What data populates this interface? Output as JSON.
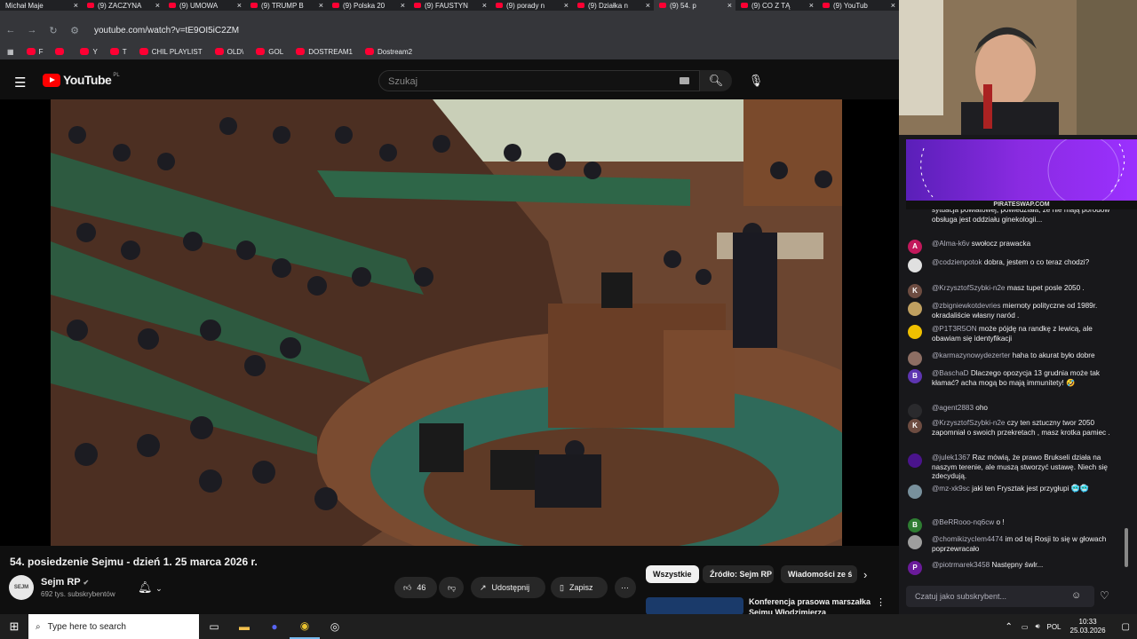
{
  "browser": {
    "tabs": [
      {
        "label": "Michał Maje"
      },
      {
        "label": "(9) ZACZYNA"
      },
      {
        "label": "(9) UMOWA"
      },
      {
        "label": "(9) TRUMP B"
      },
      {
        "label": "(9) Polska 20"
      },
      {
        "label": "(9) FAUSTYN"
      },
      {
        "label": "(9) porady n"
      },
      {
        "label": "(9) Działka n"
      },
      {
        "label": "(9) 54. p"
      },
      {
        "label": "(9) CO Z TĄ"
      },
      {
        "label": "(9) YouTub"
      }
    ],
    "url": "youtube.com/watch?v=tE9OI5iC2ZM",
    "bookmarks": [
      {
        "label": "F"
      },
      {
        "label": ""
      },
      {
        "label": "Y"
      },
      {
        "label": "T"
      },
      {
        "label": "CHIL PLAYLIST"
      },
      {
        "label": "OLD\\"
      },
      {
        "label": "GOL"
      },
      {
        "label": "DOSTREAM1"
      },
      {
        "label": "Dostream2"
      }
    ]
  },
  "youtube": {
    "logo_text": "YouTube",
    "logo_region": "PL",
    "search_placeholder": "Szukaj",
    "video_title": "54. posiedzenie Sejmu - dzień 1. 25 marca 2026 r.",
    "channel": {
      "name": "Sejm RP",
      "subs": "692 tys. subskrybentów",
      "avatar_text": "SEJM"
    },
    "actions": {
      "likes": "46",
      "share": "Udostępnij",
      "save": "Zapisz"
    },
    "chips": [
      "Wszystkie",
      "Źródło: Sejm RP",
      "Wiadomości ze ś"
    ],
    "recommendation": {
      "title": "Konferencja prasowa marszałka Sejmu Włodzimierza"
    }
  },
  "stream": {
    "banner_caption": "PIRATESWAP.COM",
    "chat_input_placeholder": "Czatuj jako subskrybent...",
    "messages": [
      {
        "user": "",
        "text": "sytuacja powiatowej, powiedziała, że nie mają porodów obsługa jest oddziału ginekologii...",
        "av": "",
        "color": "#3a3a3d"
      },
      {
        "user": "@Alma-k6v",
        "text": "swołocz prawacka",
        "av": "A",
        "color": "#c2185b"
      },
      {
        "user": "@codzienpotok",
        "text": "dobra, jestem o co teraz chodzi?",
        "av": "",
        "color": "#e0e0e0"
      },
      {
        "user": "@KrzysztofSzybki-n2e",
        "text": "masz tupet posle 2050 .",
        "av": "K",
        "color": "#6d4c41"
      },
      {
        "user": "@zbigniewkotdevries",
        "text": "miernoty polityczne od 1989r. okradaliście własny naród .",
        "av": "",
        "color": "#c0a060"
      },
      {
        "user": "@P1T3R5ON",
        "text": "może pójdę na randkę z lewicą, ale obawiam się identyfikacji",
        "av": "",
        "color": "#f0c000"
      },
      {
        "user": "@karmazynowydezerter",
        "text": "haha to akurat było dobre",
        "av": "",
        "color": "#8d6e63"
      },
      {
        "user": "@BaschaD",
        "text": "Dlaczego opozycja 13 grudnia może tak kłamać? acha mogą bo mają immunitety! 🤣",
        "av": "B",
        "color": "#5e35b1"
      },
      {
        "user": "@agent2883",
        "text": "oho",
        "av": "",
        "color": "#2a2a2d"
      },
      {
        "user": "@KrzysztofSzybki-n2e",
        "text": "czy ten sztuczny twor 2050 zapomniał o swoich przekretach , masz krotka pamiec .",
        "av": "K",
        "color": "#6d4c41"
      },
      {
        "user": "@julek1367",
        "text": "Raz mówią, że prawo Brukseli działa na naszym terenie, ale muszą stworzyć ustawę. Niech się zdecydują.",
        "av": "",
        "color": "#4a148c"
      },
      {
        "user": "@mz-xk9sc",
        "text": "jaki ten Frysztak jest przygłupi 🥶🥶",
        "av": "",
        "color": "#78909c"
      },
      {
        "user": "@BeRRooo-nq6cw",
        "text": "o !",
        "av": "B",
        "color": "#2e7d32"
      },
      {
        "user": "@chomikizycIem4474",
        "text": "im od tej Rosji to się w głowach poprzewracało",
        "av": "",
        "color": "#9e9e9e"
      },
      {
        "user": "@piotrmarek3458",
        "text": "Następny śwlr...",
        "av": "P",
        "color": "#6a1b9a"
      }
    ]
  },
  "taskbar": {
    "search_placeholder": "Type here to search",
    "lang": "POL",
    "time": "10:33",
    "date": "25.03.2026"
  },
  "colors": {
    "accent": "#ff0000",
    "bg": "#0f0f0f",
    "chat_bg": "#18181b"
  }
}
